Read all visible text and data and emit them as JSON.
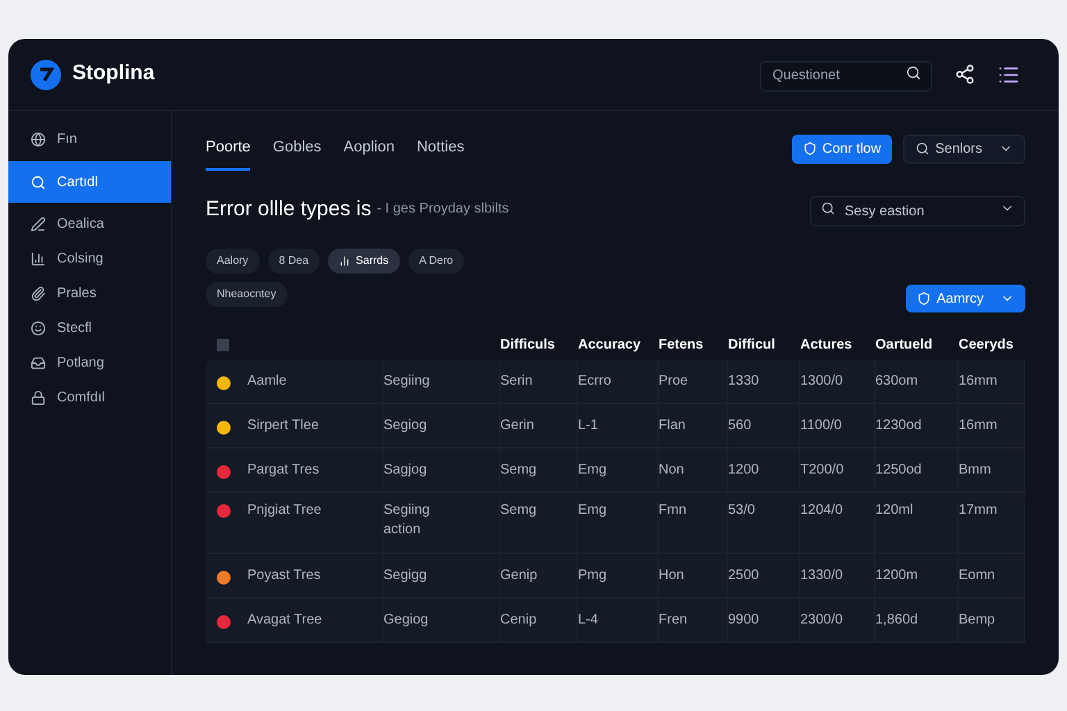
{
  "app": {
    "name": "Stoplina"
  },
  "header": {
    "search": {
      "placeholder": "Questionet"
    }
  },
  "sidebar": {
    "items": [
      {
        "label": "Fın",
        "selected": false
      },
      {
        "label": "Cartıdl",
        "selected": true
      },
      {
        "label": "Oealica",
        "selected": false
      },
      {
        "label": "Colsing",
        "selected": false
      },
      {
        "label": "Prales",
        "selected": false
      },
      {
        "label": "Stecfl",
        "selected": false
      },
      {
        "label": "Potlang",
        "selected": false
      },
      {
        "label": "Comfdıl",
        "selected": false
      }
    ]
  },
  "tabs": [
    {
      "label": "Poorte",
      "selected": true
    },
    {
      "label": "Gobles",
      "selected": false
    },
    {
      "label": "Aoplion",
      "selected": false
    },
    {
      "label": "Notties",
      "selected": false
    }
  ],
  "actions": {
    "primary": "Conr tlow",
    "select": "Senlors"
  },
  "heading": {
    "title": "Error ollle types is",
    "subtitle": "- I ges Proyday slbilts"
  },
  "section_select": {
    "placeholder": "Sesy eastion"
  },
  "chips": [
    {
      "label": "Aalory",
      "selected": false
    },
    {
      "label": "8 Dea",
      "selected": false
    },
    {
      "label": "Sarrds",
      "selected": true
    },
    {
      "label": "A Dero",
      "selected": false
    },
    {
      "label": "Nheaocntey",
      "selected": false
    }
  ],
  "filter_button": "Aamrcy",
  "table": {
    "select_all": {
      "checked": false
    },
    "columns": [
      "",
      "",
      "Difficuls",
      "Accuracy",
      "Fetens",
      "Difficul",
      "Actures",
      "Oartueld",
      "Ceeryds"
    ],
    "rows": [
      {
        "color": "#f5b70a",
        "cells": [
          "Aamle",
          "Segiing",
          "Serin",
          "Ecrro",
          "Proe",
          "1330",
          "1300/0",
          "630om",
          "16mm"
        ]
      },
      {
        "color": "#f5b70a",
        "cells": [
          "Sirpert Tlee",
          "Segiog",
          "Gerin",
          "L-1",
          "Flan",
          "560",
          "1100/0",
          "1230od",
          "16mm"
        ]
      },
      {
        "color": "#e5283b",
        "cells": [
          "Pargat Tres",
          "Sagjog",
          "Semg",
          "Emg",
          "Non",
          "1200",
          "T200/0",
          "1250od",
          "Bmm"
        ]
      },
      {
        "color": "#e5283b",
        "cells": [
          "Pnjgiat Tree",
          "Segiing\naction",
          "Semg",
          "Emg",
          "Fmn",
          "53/0",
          "1204/0",
          "120ml",
          "17mm"
        ]
      },
      {
        "color": "#f07a2a",
        "cells": [
          "Poyast Tres",
          "Segigg",
          "Genip",
          "Pmg",
          "Hon",
          "2500",
          "1330/0",
          "1200m",
          "Eomn"
        ]
      },
      {
        "color": "#e5283b",
        "cells": [
          "Avagat Tree",
          "Gegiog",
          "Cenip",
          "L-4",
          "Fren",
          "9900",
          "2300/0",
          "1,860d",
          "Bemp"
        ]
      }
    ]
  }
}
